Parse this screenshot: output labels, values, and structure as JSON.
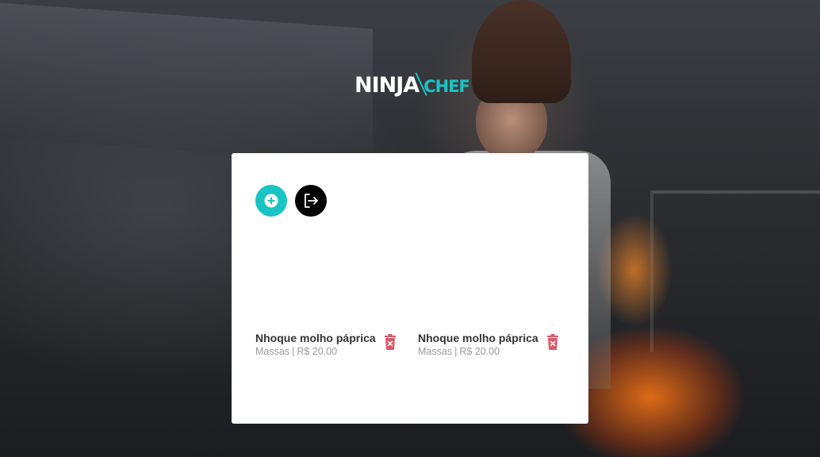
{
  "app": {
    "logo_primary": "NINJA",
    "logo_secondary": "CHEF"
  },
  "toolbar": {
    "add_icon": "plus-circle-icon",
    "logout_icon": "logout-icon",
    "accent_color": "#19c4c4"
  },
  "items": [
    {
      "name": "Nhoque molho páprica",
      "category": "Massas",
      "separator": "|",
      "price": "R$ 20.00",
      "delete_icon": "trash-icon",
      "delete_color": "#e05565"
    },
    {
      "name": "Nhoque molho páprica",
      "category": "Massas",
      "separator": "|",
      "price": "R$ 20.00",
      "delete_icon": "trash-icon",
      "delete_color": "#e05565"
    }
  ]
}
